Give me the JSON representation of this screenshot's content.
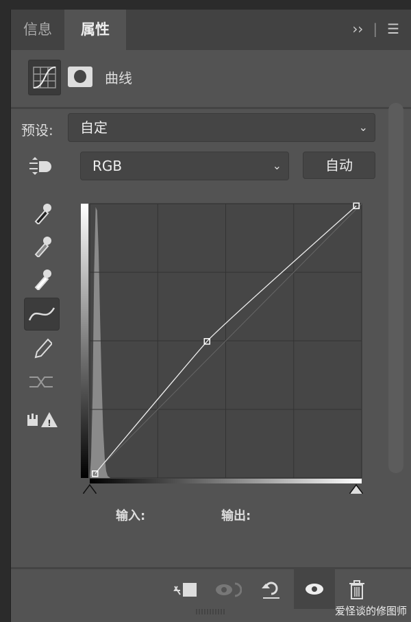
{
  "tabs": [
    {
      "label": "信息",
      "active": false
    },
    {
      "label": "属性",
      "active": true
    }
  ],
  "tab_icons": {
    "expand": "double-chevron-right-icon",
    "menu": "hamburger-menu-icon"
  },
  "header": {
    "title": "曲线"
  },
  "preset": {
    "label": "预设:",
    "value": "自定"
  },
  "channel": {
    "value": "RGB",
    "auto_label": "自动"
  },
  "tools": [
    "on-image-adjust-icon",
    "eyedropper-black-icon",
    "eyedropper-gray-icon",
    "eyedropper-white-icon",
    "curve-point-icon",
    "pencil-icon",
    "smooth-icon",
    "clipping-warning-icon"
  ],
  "curve": {
    "points": [
      [
        5,
        4
      ],
      [
        110,
        127
      ],
      [
        250,
        253
      ]
    ],
    "xlim": [
      0,
      255
    ],
    "ylim": [
      0,
      255
    ]
  },
  "readout": {
    "input_label": "输入:",
    "output_label": "输出:"
  },
  "footer_icons": [
    "clip-to-layer-icon",
    "view-previous-state-icon",
    "reset-icon",
    "visibility-eye-icon",
    "delete-trash-icon"
  ],
  "watermark": "爱怪谈的修图师"
}
